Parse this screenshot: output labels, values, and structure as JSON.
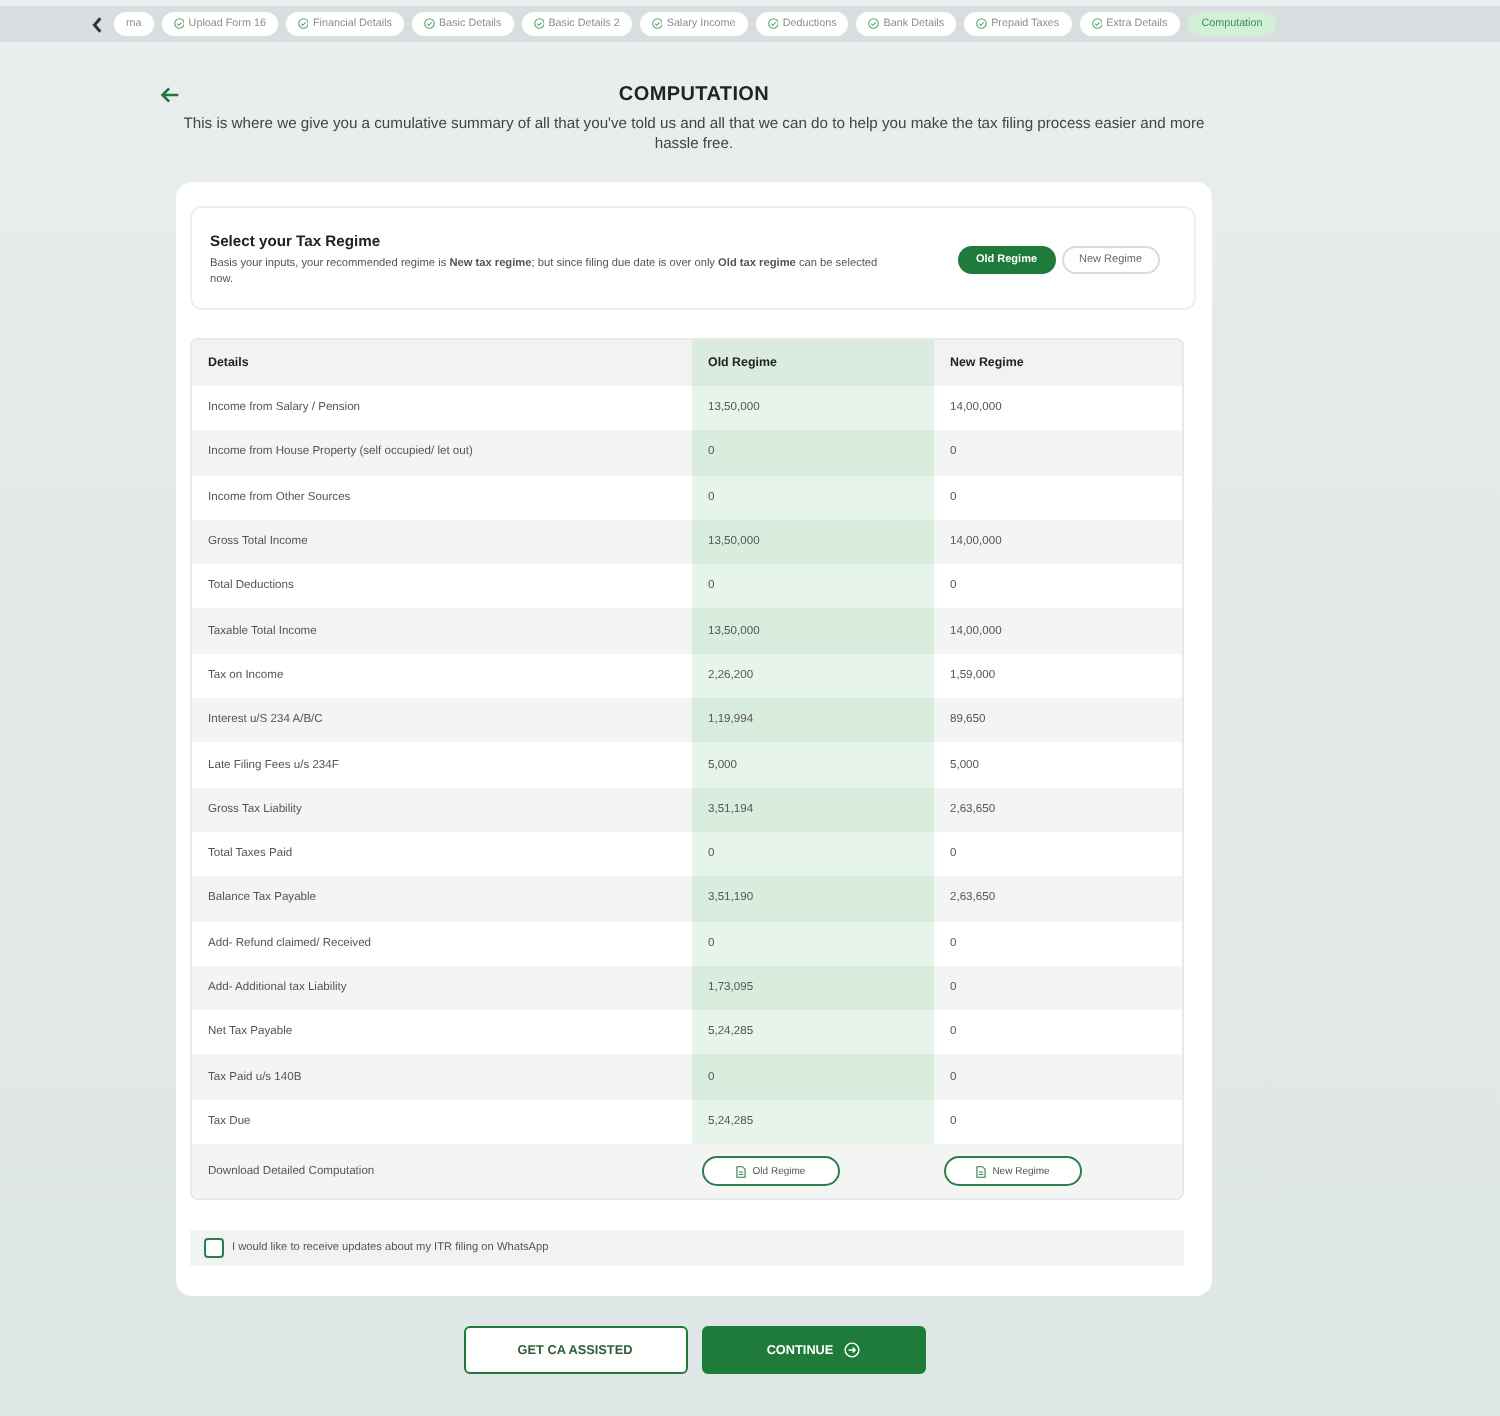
{
  "progress_steps": {
    "items": [
      {
        "label": "rna",
        "completed": false,
        "selected": false
      },
      {
        "label": "Upload Form 16",
        "completed": true,
        "selected": false
      },
      {
        "label": "Financial Details",
        "completed": true,
        "selected": false
      },
      {
        "label": "Basic Details",
        "completed": true,
        "selected": false
      },
      {
        "label": "Basic Details 2",
        "completed": true,
        "selected": false
      },
      {
        "label": "Salary Income",
        "completed": true,
        "selected": false
      },
      {
        "label": "Deductions",
        "completed": true,
        "selected": false
      },
      {
        "label": "Bank Details",
        "completed": true,
        "selected": false
      },
      {
        "label": "Prepaid Taxes",
        "completed": true,
        "selected": false
      },
      {
        "label": "Extra Details",
        "completed": true,
        "selected": false
      },
      {
        "label": "Computation",
        "completed": false,
        "selected": true
      }
    ]
  },
  "header": {
    "title": "COMPUTATION",
    "subtitle": "This is where we give you a cumulative summary of all that you've told us and all that we can do to help you make the tax filing process easier and more hassle free."
  },
  "regime": {
    "title": "Select your Tax Regime",
    "description": "Basis your inputs, your recommended regime is **New tax regime**; but since filing due date is over only **Old tax regime** can be selected now.",
    "options": [
      {
        "label": "Old Regime",
        "selected": true
      },
      {
        "label": "New Regime",
        "selected": false
      }
    ]
  },
  "table": {
    "columns": [
      "Details",
      "Old Regime",
      "New Regime"
    ],
    "rows": [
      {
        "details": "Income from Salary / Pension",
        "old_regime": "13,50,000",
        "new_regime": "14,00,000"
      },
      {
        "details": "Income from House Property (self occupied/ let out)",
        "old_regime": "0",
        "new_regime": "0"
      },
      {
        "details": "Income from Other Sources",
        "old_regime": "0",
        "new_regime": "0"
      },
      {
        "details": "Gross Total Income",
        "old_regime": "13,50,000",
        "new_regime": "14,00,000"
      },
      {
        "details": "Total Deductions",
        "old_regime": "0",
        "new_regime": "0"
      },
      {
        "details": "Taxable Total Income",
        "old_regime": "13,50,000",
        "new_regime": "14,00,000"
      },
      {
        "details": "Tax on Income",
        "old_regime": "2,26,200",
        "new_regime": "1,59,000"
      },
      {
        "details": "Interest u/S 234 A/B/C",
        "old_regime": "1,19,994",
        "new_regime": "89,650"
      },
      {
        "details": "Late Filing Fees u/s 234F",
        "old_regime": "5,000",
        "new_regime": "5,000"
      },
      {
        "details": "Gross Tax Liability",
        "old_regime": "3,51,194",
        "new_regime": "2,63,650"
      },
      {
        "details": "Total Taxes Paid",
        "old_regime": "0",
        "new_regime": "0"
      },
      {
        "details": "Balance Tax Payable",
        "old_regime": "3,51,190",
        "new_regime": "2,63,650"
      },
      {
        "details": "Add- Refund claimed/ Received",
        "old_regime": "0",
        "new_regime": "0"
      },
      {
        "details": "Add- Additional tax Liability",
        "old_regime": "1,73,095",
        "new_regime": "0"
      },
      {
        "details": "Net Tax Payable",
        "old_regime": "5,24,285",
        "new_regime": "0"
      },
      {
        "details": "Tax Paid u/s 140B",
        "old_regime": "0",
        "new_regime": "0"
      },
      {
        "details": "Tax Due",
        "old_regime": "5,24,285",
        "new_regime": "0"
      }
    ],
    "download": {
      "label": "Download Detailed Computation",
      "buttons": [
        "Old Regime",
        "New Regime"
      ]
    }
  },
  "whatsapp": {
    "label": "I would like to receive updates about my ITR filing on WhatsApp",
    "checked": false
  },
  "buttons": [
    {
      "label": "GET CA ASSISTED",
      "kind": "outline"
    },
    {
      "label": "CONTINUE",
      "kind": "primary"
    }
  ]
}
